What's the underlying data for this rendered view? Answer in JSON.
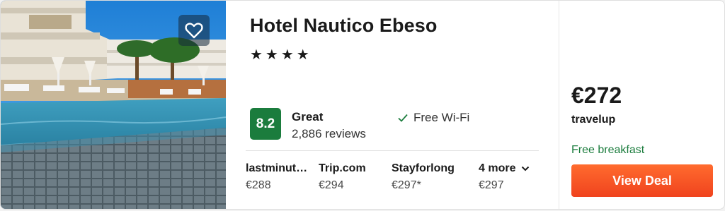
{
  "hotel": {
    "name": "Hotel Nautico Ebeso",
    "star_rating": 4,
    "stars_text": "★★★★",
    "favorite_icon": "heart-outline-icon"
  },
  "rating": {
    "score": "8.2",
    "label": "Great",
    "reviews": "2,886 reviews",
    "badge_color": "#1b7c3d"
  },
  "amenities": [
    {
      "icon": "checkmark-icon",
      "label": "Free Wi-Fi"
    }
  ],
  "providers": [
    {
      "name": "lastminut…",
      "price": "€288"
    },
    {
      "name": "Trip.com",
      "price": "€294"
    },
    {
      "name": "Stayforlong",
      "price": "€297*"
    },
    {
      "name": "4 more",
      "price": "€297",
      "icon": "chevron-down-icon"
    }
  ],
  "deal": {
    "price": "€272",
    "vendor": "travelup",
    "perk": "Free breakfast",
    "button_label": "View Deal",
    "button_color": "#f05423",
    "perk_color": "#1b7c3d"
  }
}
